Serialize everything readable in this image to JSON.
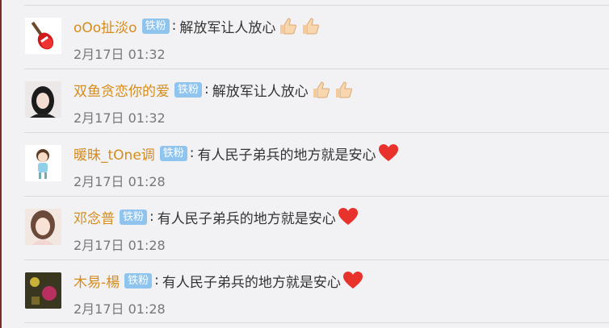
{
  "comments": [
    {
      "name": "oOo扯淡o",
      "badge": "铁粉",
      "text": "解放军让人放心",
      "emoji": [
        "thumbs-up-icon",
        "thumbs-up-icon"
      ],
      "time": "2月17日 01:32"
    },
    {
      "name": "双鱼贪恋你的爱",
      "badge": "铁粉",
      "text": "解放军让人放心",
      "emoji": [
        "thumbs-up-icon",
        "thumbs-up-icon"
      ],
      "time": "2月17日 01:32"
    },
    {
      "name": "暖昧_tOne调",
      "badge": "铁粉",
      "text": "有人民子弟兵的地方就是安心",
      "emoji": [
        "heart-icon"
      ],
      "time": "2月17日 01:28"
    },
    {
      "name": "邓念普",
      "badge": "铁粉",
      "text": "有人民子弟兵的地方就是安心",
      "emoji": [
        "heart-icon"
      ],
      "time": "2月17日 01:28"
    },
    {
      "name": "木易-楊",
      "badge": "铁粉",
      "text": "有人民子弟兵的地方就是安心",
      "emoji": [
        "heart-icon"
      ],
      "time": "2月17日 01:28"
    }
  ],
  "colors": {
    "name": "#d68c1a",
    "badge": "#8fc4ee",
    "time": "#777777",
    "heart": "#e8322c"
  }
}
